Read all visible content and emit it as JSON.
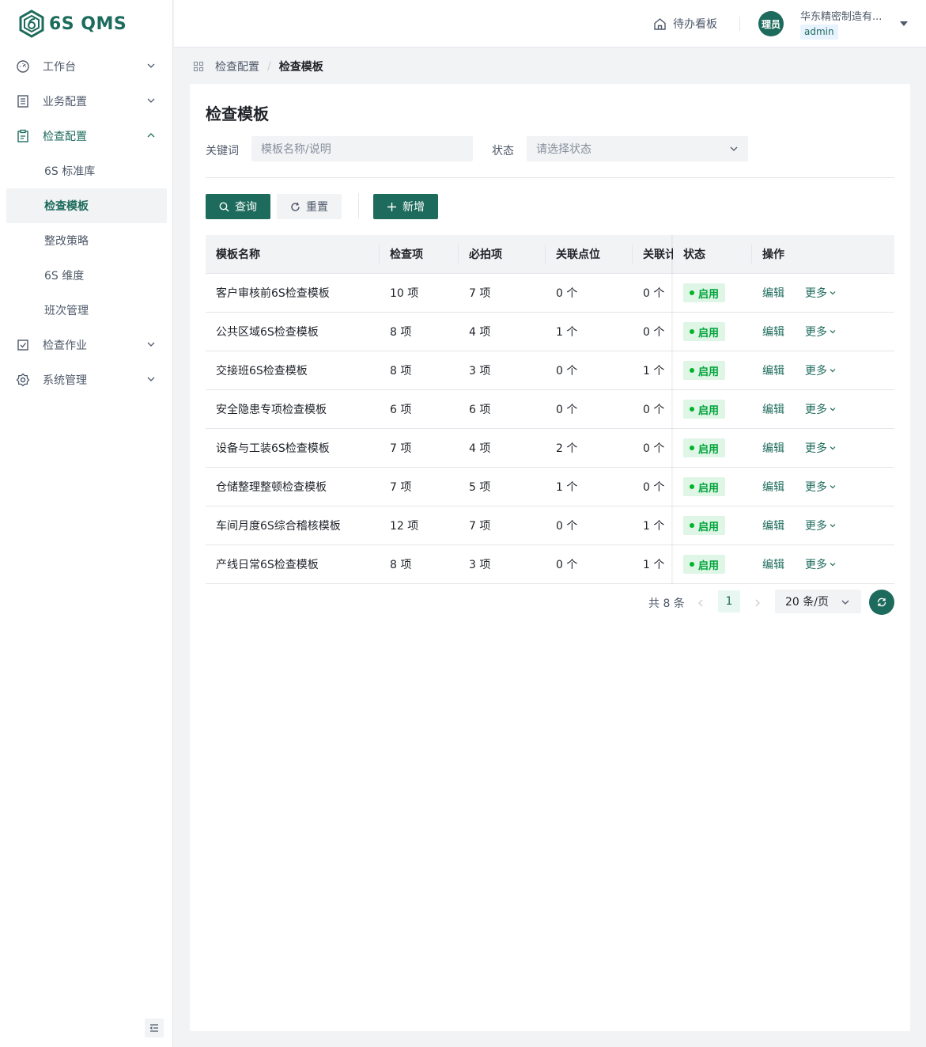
{
  "app": {
    "logo_text": "6S QMS",
    "brand_color": "#1d6b5c"
  },
  "sidebar": {
    "items": [
      {
        "label": "工作台",
        "icon": "dashboard-icon",
        "expanded": false
      },
      {
        "label": "业务配置",
        "icon": "document-icon",
        "expanded": false
      },
      {
        "label": "检查配置",
        "icon": "clipboard-icon",
        "expanded": true,
        "children": [
          {
            "label": "6S 标准库"
          },
          {
            "label": "检查模板",
            "active": true
          },
          {
            "label": "整改策略"
          },
          {
            "label": "6S 维度"
          },
          {
            "label": "班次管理"
          }
        ]
      },
      {
        "label": "检查作业",
        "icon": "checkbox-icon",
        "expanded": false
      },
      {
        "label": "系统管理",
        "icon": "gear-icon",
        "expanded": false
      }
    ]
  },
  "header": {
    "todo_label": "待办看板",
    "avatar_text": "理员",
    "org_name": "华东精密制造有...",
    "role": "admin"
  },
  "breadcrumb": {
    "parent": "检查配置",
    "current": "检查模板"
  },
  "page": {
    "title": "检查模板"
  },
  "filters": {
    "keyword_label": "关键词",
    "keyword_placeholder": "模板名称/说明",
    "status_label": "状态",
    "status_placeholder": "请选择状态"
  },
  "actions": {
    "query": "查询",
    "reset": "重置",
    "add": "新增"
  },
  "table": {
    "columns": [
      "模板名称",
      "检查项",
      "必拍项",
      "关联点位",
      "关联计",
      "状态",
      "操作"
    ],
    "rows": [
      {
        "name": "客户审核前6S检查模板",
        "items": "10 项",
        "photos": "7 项",
        "points": "0 个",
        "plans": "0 个",
        "status": "启用"
      },
      {
        "name": "公共区域6S检查模板",
        "items": "8 项",
        "photos": "4 项",
        "points": "1 个",
        "plans": "0 个",
        "status": "启用"
      },
      {
        "name": "交接班6S检查模板",
        "items": "8 项",
        "photos": "3 项",
        "points": "0 个",
        "plans": "1 个",
        "status": "启用"
      },
      {
        "name": "安全隐患专项检查模板",
        "items": "6 项",
        "photos": "6 项",
        "points": "0 个",
        "plans": "0 个",
        "status": "启用"
      },
      {
        "name": "设备与工装6S检查模板",
        "items": "7 项",
        "photos": "4 项",
        "points": "2 个",
        "plans": "0 个",
        "status": "启用"
      },
      {
        "name": "仓储整理整顿检查模板",
        "items": "7 项",
        "photos": "5 项",
        "points": "1 个",
        "plans": "0 个",
        "status": "启用"
      },
      {
        "name": "车间月度6S综合稽核模板",
        "items": "12 项",
        "photos": "7 项",
        "points": "0 个",
        "plans": "1 个",
        "status": "启用"
      },
      {
        "name": "产线日常6S检查模板",
        "items": "8 项",
        "photos": "3 项",
        "points": "0 个",
        "plans": "1 个",
        "status": "启用"
      }
    ],
    "edit_label": "编辑",
    "more_label": "更多"
  },
  "pagination": {
    "total": "共 8 条",
    "current_page": "1",
    "page_size": "20 条/页"
  }
}
